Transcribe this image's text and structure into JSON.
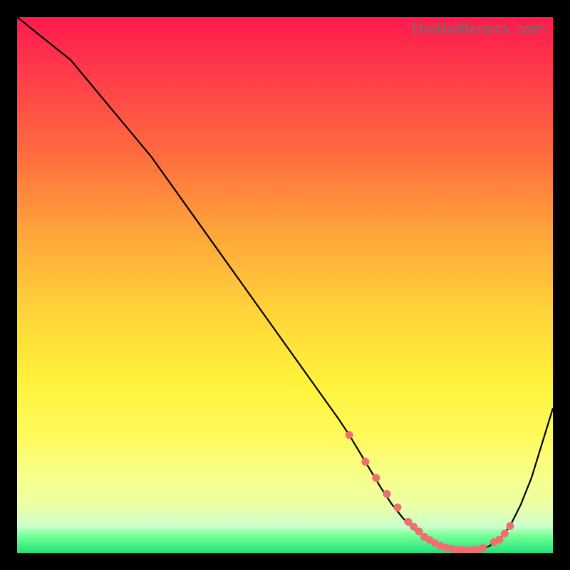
{
  "watermark": "TheBottleneck.com",
  "colors": {
    "frame": "#000000",
    "curve": "#000000",
    "marker_fill": "#ef6f6f",
    "marker_stroke": "#c24a4a"
  },
  "chart_data": {
    "type": "line",
    "title": "",
    "xlabel": "",
    "ylabel": "",
    "xlim": [
      0,
      100
    ],
    "ylim": [
      0,
      100
    ],
    "annotations": [],
    "series": [
      {
        "name": "curve",
        "x": [
          0,
          5,
          10,
          15,
          20,
          25,
          30,
          35,
          40,
          45,
          50,
          55,
          60,
          62,
          65,
          68,
          70,
          72,
          74,
          76,
          78,
          80,
          82,
          84,
          86,
          88,
          90,
          92,
          94,
          96,
          100
        ],
        "y": [
          100,
          96,
          92,
          86,
          80,
          74,
          67,
          60,
          53,
          46,
          39,
          32,
          25,
          22,
          17,
          12,
          9,
          6.5,
          4.5,
          3,
          1.8,
          1.0,
          0.6,
          0.5,
          0.6,
          1.2,
          2.5,
          5,
          9,
          14,
          27
        ]
      }
    ],
    "markers": {
      "name": "bottom-cluster",
      "x": [
        62,
        65,
        67,
        69,
        71,
        73,
        74,
        75,
        76,
        77,
        78,
        79,
        80,
        81,
        82,
        83,
        84,
        85,
        86,
        87,
        89,
        90,
        91,
        92
      ],
      "y": [
        22,
        17,
        14,
        11,
        8.5,
        5.8,
        4.9,
        4.0,
        3.0,
        2.4,
        1.8,
        1.3,
        1.0,
        0.8,
        0.6,
        0.55,
        0.5,
        0.55,
        0.6,
        0.9,
        2.0,
        2.5,
        3.6,
        5.0
      ]
    }
  }
}
